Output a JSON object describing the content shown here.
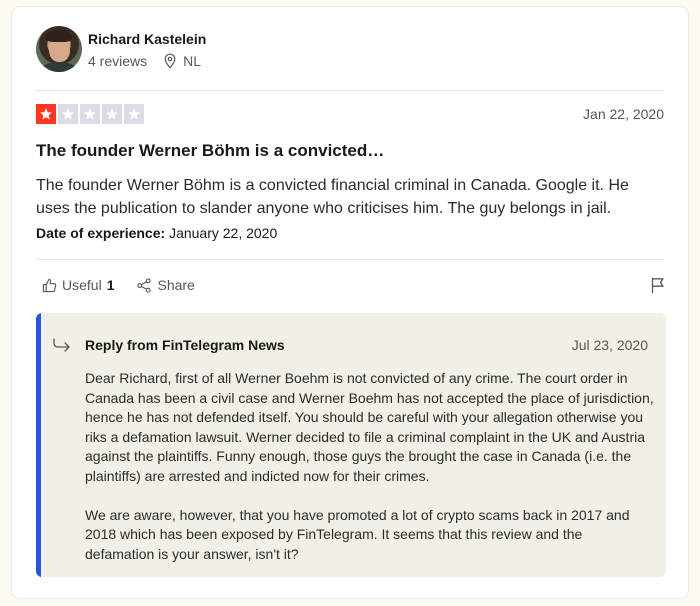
{
  "reviewer": {
    "name": "Richard Kastelein",
    "reviews": "4 reviews",
    "country": "NL"
  },
  "review": {
    "rating": 1,
    "max_rating": 5,
    "date": "Jan 22, 2020",
    "title": "The founder Werner Böhm is a convicted…",
    "text": "The founder Werner Böhm is a convicted financial criminal in Canada. Google it. He uses the publication to slander anyone who criticises him. The guy belongs in jail.",
    "experience_label": "Date of experience:",
    "experience_date": "January 22, 2020",
    "star_color": "#ff3722",
    "empty_star_color": "#dcdce6"
  },
  "actions": {
    "useful_label": "Useful",
    "useful_count": "1",
    "share_label": "Share"
  },
  "reply": {
    "title": "Reply from FinTelegram News",
    "date": "Jul 23, 2020",
    "paragraph1": "Dear Richard, first of all Werner Boehm is not convicted of any crime. The court order in Canada has been a civil case and Werner Boehm has not accepted the place of jurisdiction, hence he has not defended itself. You should be careful with your allegation otherwise you riks a defamation lawsuit. Werner decided to file a criminal complaint in the UK and Austria against the plaintiffs. Funny enough, those guys the brought the case in Canada (i.e. the plaintiffs) are arrested and indicted now for their crimes.",
    "paragraph2": "We are aware, however, that you have promoted a lot of crypto scams back in 2017 and 2018 which has been exposed by FinTelegram. It seems that this review and the defamation is your answer, isn't it?",
    "accent_color": "#2457d6"
  }
}
